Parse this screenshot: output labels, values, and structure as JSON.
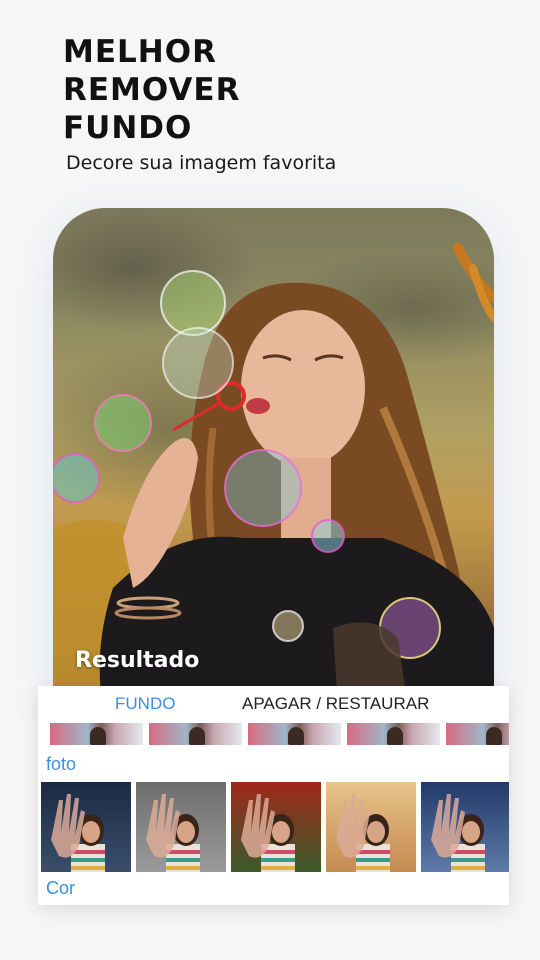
{
  "headline": {
    "line1": "MELHOR",
    "line2": "REMOVER",
    "line3": "FUNDO"
  },
  "subtitle": "Decore sua imagem favorita",
  "result_card": {
    "label": "Resultado"
  },
  "panel": {
    "tabs": [
      {
        "label": "FUNDO",
        "active": true
      },
      {
        "label": "APAGAR / RESTAURAR",
        "active": false
      }
    ],
    "section_photo": "foto",
    "section_color": "Cor",
    "photo_backgrounds": [
      {
        "name": "dark-blue-night",
        "top": "#1b2a44",
        "bottom": "#3a4e6b"
      },
      {
        "name": "grey-street",
        "top": "#6d6d6d",
        "bottom": "#9b9b9b"
      },
      {
        "name": "red-sunset",
        "top": "#a0281a",
        "bottom": "#3a5a2a"
      },
      {
        "name": "warm-beach",
        "top": "#e7c48a",
        "bottom": "#c58a52"
      },
      {
        "name": "blue-storm",
        "top": "#233a6a",
        "bottom": "#5d7aa8"
      }
    ]
  },
  "colors": {
    "accent": "#3d8fe0",
    "background": "#f6f6f7",
    "headline": "#111111"
  }
}
